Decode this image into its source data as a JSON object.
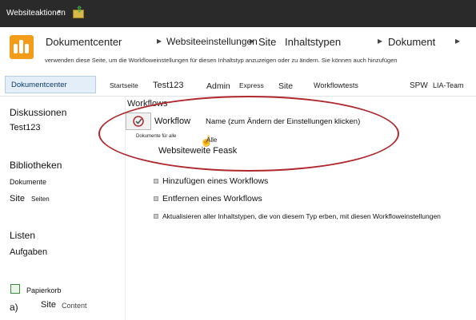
{
  "topbar": {
    "site_actions": "Websiteaktionen",
    "caret": "▾"
  },
  "breadcrumb": {
    "items": [
      "Dokumentcenter",
      "Websiteeinstellungen",
      "Site",
      "Inhaltstypen",
      "Dokument"
    ],
    "separator": "▸",
    "description": "verwenden diese Seite, um die Workfloweinstellungen für diesen Inhaltstyp anzuzeigen oder zu ändern. Sie können auch hinzufügen"
  },
  "nav": {
    "active_tab": "Dokumentcenter",
    "links": [
      "Startseite",
      "Test123",
      "Admin",
      "Express",
      "Site",
      "Workflowtests"
    ],
    "right_links": [
      "SPW",
      "LIA-Team"
    ]
  },
  "quicklaunch": {
    "discussions_heading": "Diskussionen",
    "discussions_item": "Test123",
    "libraries_heading": "Bibliotheken",
    "libraries_item": "Dokumente",
    "site_pages_a": "Site",
    "site_pages_b": "Seiten",
    "lists_heading": "Listen",
    "lists_item": "Aufgaben",
    "recycle_bin": "Papierkorb",
    "site_content_prefix": "a)",
    "site_content_a": "Site",
    "site_content_b": "Content"
  },
  "workflows": {
    "section_title": "Workflows",
    "label": "Workflow",
    "column_header": "Name (zum Ändern der Einstellungen klicken)",
    "tiny_text": "Dokumente für alle",
    "alle": "Alle",
    "task": "Websiteweite Feask"
  },
  "actions": [
    "Hinzufügen eines Workflows",
    "Entfernen eines Workflows",
    "Aktualisieren aller Inhaltstypen, die von diesem Typ erben, mit diesen Workfloweinstellungen"
  ],
  "colors": {
    "accent": "#b0282d",
    "site_icon": "#f39c1a",
    "topbar": "#2a2a2a"
  }
}
